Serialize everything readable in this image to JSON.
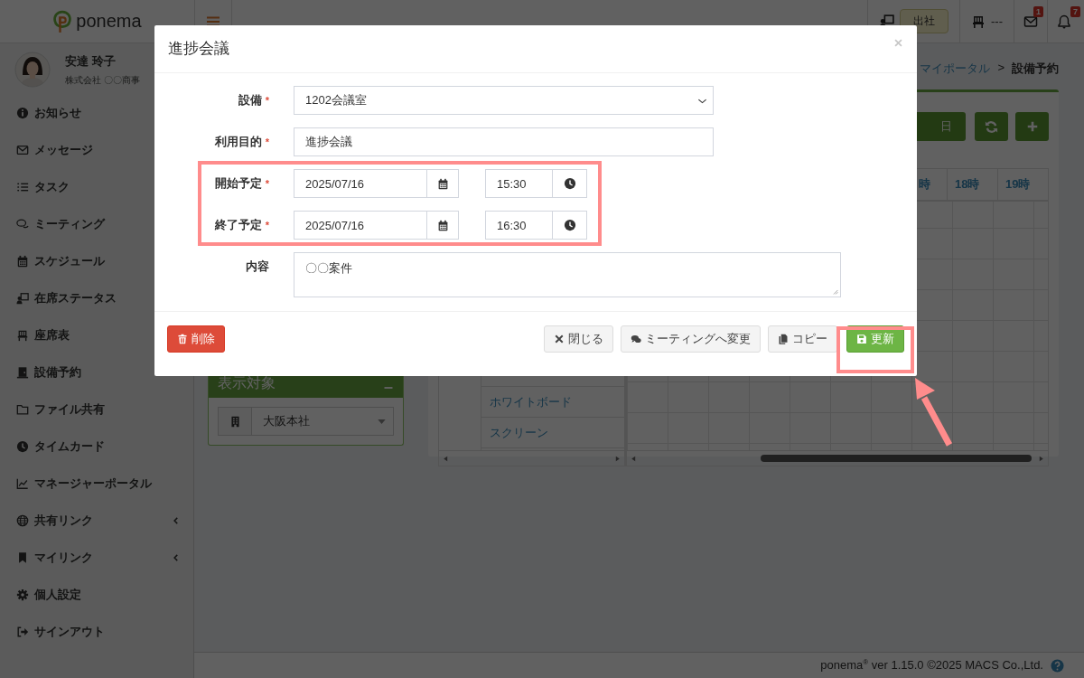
{
  "header": {
    "logo": "ponema",
    "status": "出社",
    "seat": "---",
    "mail_badge": "1",
    "bell_badge": "7"
  },
  "sidebar": {
    "user": {
      "name": "安達 玲子",
      "company": "株式会社 〇〇商事"
    },
    "items": [
      {
        "label": "お知らせ",
        "has_submenu": false
      },
      {
        "label": "メッセージ",
        "has_submenu": false
      },
      {
        "label": "タスク",
        "has_submenu": false
      },
      {
        "label": "ミーティング",
        "has_submenu": false
      },
      {
        "label": "スケジュール",
        "has_submenu": false
      },
      {
        "label": "在席ステータス",
        "has_submenu": false
      },
      {
        "label": "座席表",
        "has_submenu": false
      },
      {
        "label": "設備予約",
        "has_submenu": false
      },
      {
        "label": "ファイル共有",
        "has_submenu": false
      },
      {
        "label": "タイムカード",
        "has_submenu": false
      },
      {
        "label": "マネージャーポータル",
        "has_submenu": false
      },
      {
        "label": "共有リンク",
        "has_submenu": true
      },
      {
        "label": "マイリンク",
        "has_submenu": true
      },
      {
        "label": "個人設定",
        "has_submenu": false
      },
      {
        "label": "サインアウト",
        "has_submenu": false
      }
    ]
  },
  "breadcrumb": {
    "items": [
      "マイポータル",
      "設備予約"
    ],
    "separator": ">"
  },
  "toolbar": {
    "view_button": "日"
  },
  "filter_panel": {
    "title": "表示対象",
    "office": "大阪本社"
  },
  "schedule": {
    "time_headers": [
      "時",
      "18時",
      "19時"
    ],
    "rows": [
      {
        "name": "ホワイトボード"
      },
      {
        "name": "スクリーン"
      }
    ]
  },
  "modal": {
    "title": "進捗会議",
    "required_mark": "*",
    "fields": [
      {
        "label": "設備",
        "required": true,
        "kind": "select",
        "value": "1202会議室"
      },
      {
        "label": "利用目的",
        "required": true,
        "kind": "text",
        "value": "進捗会議"
      },
      {
        "label": "開始予定",
        "required": true,
        "kind": "datetime",
        "date": "2025/07/16",
        "time": "15:30"
      },
      {
        "label": "終了予定",
        "required": true,
        "kind": "datetime",
        "date": "2025/07/16",
        "time": "16:30"
      },
      {
        "label": "内容",
        "required": false,
        "kind": "textarea",
        "value": "〇〇案件"
      }
    ],
    "buttons": [
      {
        "label": "削除",
        "kind": "danger"
      },
      {
        "label": "閉じる",
        "kind": "default"
      },
      {
        "label": "ミーティングへ変更",
        "kind": "default"
      },
      {
        "label": "コピー",
        "kind": "default"
      },
      {
        "label": "更新",
        "kind": "primary"
      }
    ]
  },
  "footer": "ponema$^{®}$ ver 1.15.0 ©2025 MACS Co.,Ltd."
}
